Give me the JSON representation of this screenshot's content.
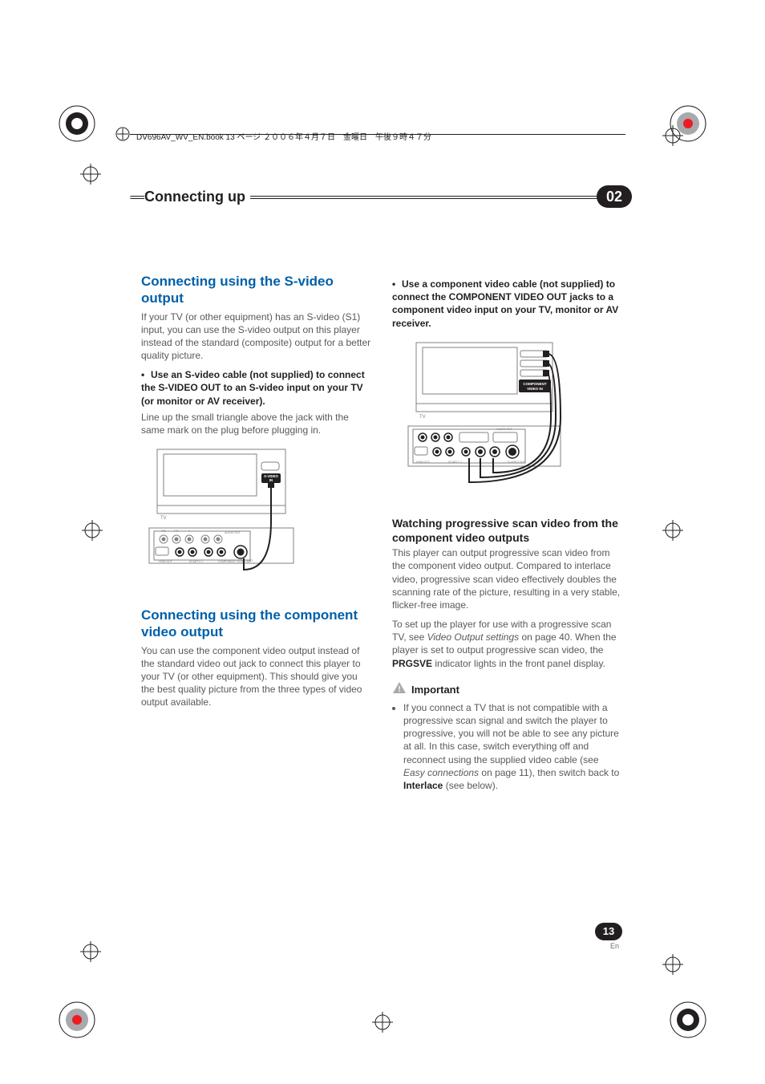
{
  "header": {
    "crop_text": "DV696AV_WV_EN.book  13 ページ  ２００６年４月７日　金曜日　午後９時４７分"
  },
  "chapter": {
    "title": "Connecting up",
    "number": "02"
  },
  "left": {
    "h_svideo": "Connecting using the S-video output",
    "p1": "If your TV (or other equipment) has an S-video (S1) input, you can use the S-video output on this player instead of the standard (composite) output for a better quality picture.",
    "bullet1": "Use an S-video cable (not supplied) to connect the S-VIDEO OUT to an S-video input on your TV (or monitor or AV receiver).",
    "p2": "Line up the small triangle above the jack with the same mark on the plug before plugging in.",
    "diagram1": {
      "tv_label": "TV",
      "svideo_in_1": "S-VIDEO",
      "svideo_in_2": "IN",
      "panel": {
        "pb": "PB",
        "pr": "PR",
        "y": "Y",
        "audio_out": "AUDIO OUT",
        "hdmi_out": "HDMI OUT",
        "scart": "SCART",
        "component_video_out": "COMPONENT VIDEO OUT",
        "l": "L",
        "r": "R",
        "s_out": "S",
        "out": "OUT"
      }
    },
    "h_component": "Connecting using the component video output",
    "p3": "You can use the component video output instead of the standard video out jack to connect this player to your TV (or other equipment). This should give you the best quality picture from the three types of video output available."
  },
  "right": {
    "bullet1": "Use a component video cable (not supplied) to connect the COMPONENT VIDEO OUT jacks to a component video input on your TV, monitor or AV receiver.",
    "diagram2": {
      "tv_label": "TV",
      "comp_in_1": "COMPONENT",
      "comp_in_2": "VIDEO IN"
    },
    "h_prog": "Watching progressive scan video from the component video outputs",
    "p1": "This player can output progressive scan video from the component video output. Compared to interlace video, progressive scan video effectively doubles the scanning rate of the picture, resulting in a very stable, flicker-free image.",
    "p2a": "To set up the player for use with a progressive scan TV, see ",
    "p2_em": "Video Output settings",
    "p2b": " on page 40. When the player is set to output progressive scan video, the ",
    "p2_bold": "PRGSVE",
    "p2c": " indicator lights in the front panel display.",
    "important_label": "Important",
    "note_a": "If you connect a TV that is not compatible with a progressive scan signal and switch the player to progressive, you will not be able to see any picture at all. In this case, switch everything off and reconnect using the supplied video cable (see ",
    "note_em": "Easy connections",
    "note_b": " on page 11), then switch back to ",
    "note_bold": "Interlace",
    "note_c": " (see below)."
  },
  "footer": {
    "page": "13",
    "lang": "En"
  }
}
